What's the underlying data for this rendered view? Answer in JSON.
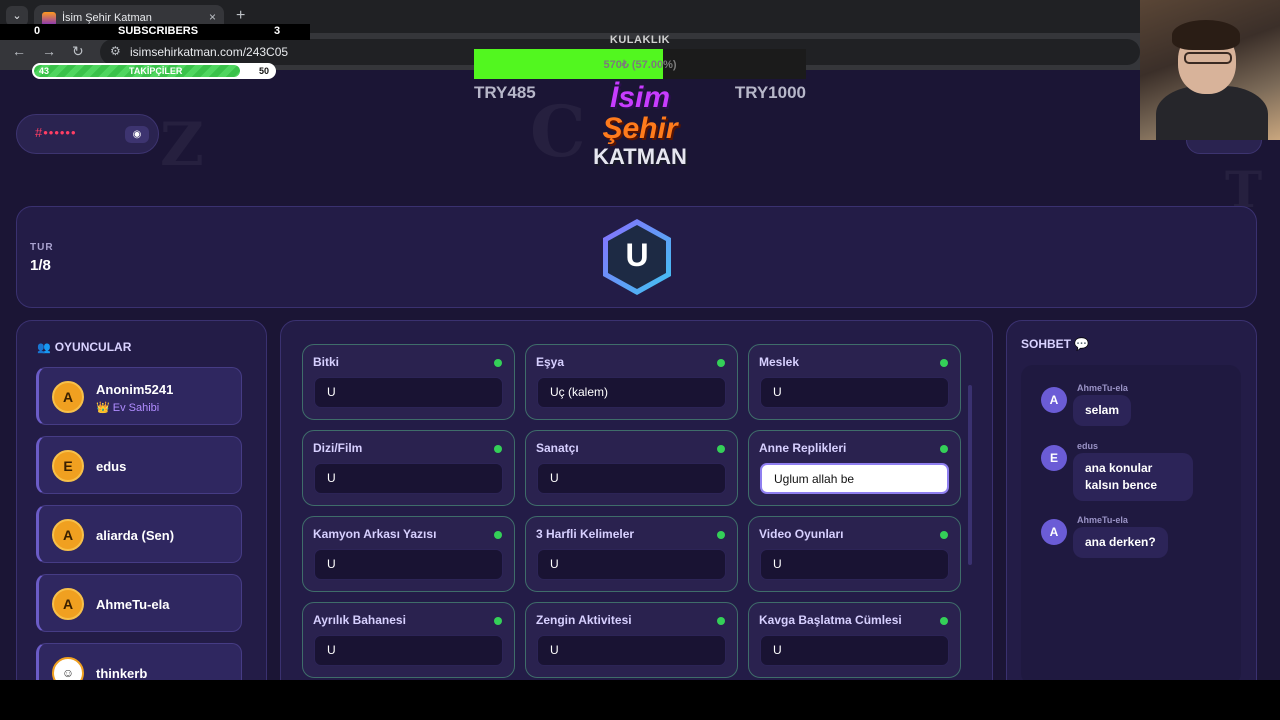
{
  "browser": {
    "tab_title": "İsim Şehir Katman",
    "url": "isimsehirkatman.com/243C05",
    "tab_list_icon": "chevron-down-icon",
    "close_icon": "×",
    "new_tab_icon": "+",
    "back_icon": "←",
    "forward_icon": "→",
    "reload_icon": "↻",
    "tune_icon": "⚙"
  },
  "overlay": {
    "subscribers": {
      "left": "0",
      "label": "SUBSCRIBERS",
      "right": "3"
    },
    "followers": {
      "current": "43",
      "label": "TAKİPÇİLER",
      "goal": "50",
      "fill_fraction": 0.86
    },
    "goal": {
      "title": "KULAKLIK",
      "progress_text": "570₺ (57.00%)",
      "fill_fraction": 0.57,
      "start": "TRY485",
      "end": "TRY1000"
    }
  },
  "game": {
    "logo": {
      "line1": "İsim",
      "line2": "Şehir",
      "line3": "KATMAN"
    },
    "room_code_mask": "#••••••",
    "eye_icon": "◉",
    "round": {
      "label": "TUR",
      "value": "1/8"
    },
    "current_letter": "U",
    "players_title": "OYUNCULAR",
    "players": [
      {
        "initial": "A",
        "name": "Anonim5241",
        "badge": "👑 Ev Sahibi"
      },
      {
        "initial": "E",
        "name": "edus"
      },
      {
        "initial": "A",
        "name": "aliarda (Sen)"
      },
      {
        "initial": "A",
        "name": "AhmeTu-ela"
      },
      {
        "initial": "☺",
        "name": "thinkerb"
      }
    ],
    "categories": [
      {
        "name": "Bitki",
        "value": "U"
      },
      {
        "name": "Eşya",
        "value": "Uç (kalem)"
      },
      {
        "name": "Meslek",
        "value": "U"
      },
      {
        "name": "Dizi/Film",
        "value": "U"
      },
      {
        "name": "Sanatçı",
        "value": "U"
      },
      {
        "name": "Anne Replikleri",
        "value": "Uglum allah be"
      },
      {
        "name": "Kamyon Arkası Yazısı",
        "value": "U"
      },
      {
        "name": "3 Harfli Kelimeler",
        "value": "U"
      },
      {
        "name": "Video Oyunları",
        "value": "U"
      },
      {
        "name": "Ayrılık Bahanesi",
        "value": "U"
      },
      {
        "name": "Zengin Aktivitesi",
        "value": "U"
      },
      {
        "name": "Kavga Başlatma Cümlesi",
        "value": "U"
      }
    ],
    "chat_title": "SOHBET 💬",
    "messages": [
      {
        "initial": "A",
        "user": "AhmeTu-ela",
        "text": "selam"
      },
      {
        "initial": "E",
        "user": "edus",
        "text": "ana konular kalsın bence"
      },
      {
        "initial": "A",
        "user": "AhmeTu-ela",
        "text": "ana derken?"
      }
    ]
  },
  "colors": {
    "bg": "#1b1535",
    "panel": "#231c47",
    "accent": "#6b5cd6",
    "green": "#34d058",
    "goal": "#52f71f"
  }
}
